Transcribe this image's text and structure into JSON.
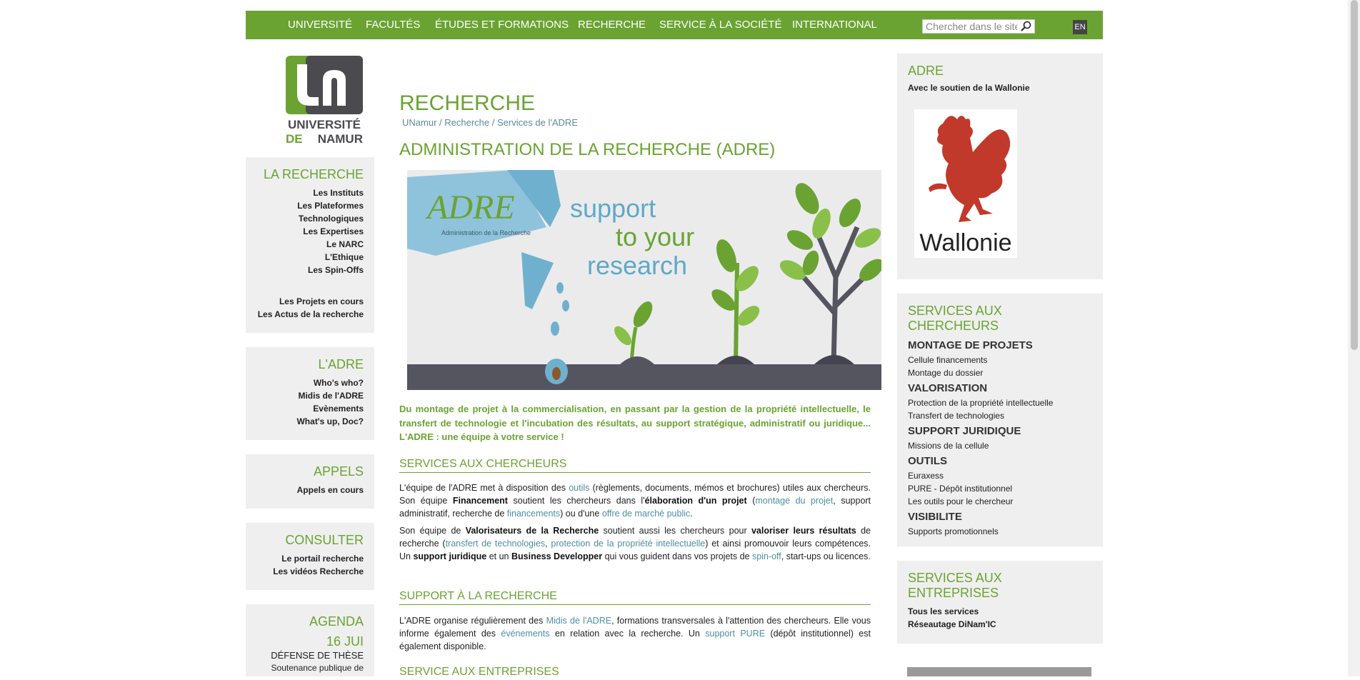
{
  "nav": {
    "items": [
      "UNIVERSITÉ",
      "FACULTÉS",
      "ÉTUDES ET FORMATIONS",
      "RECHERCHE",
      "SERVICE À LA SOCIÉTÉ",
      "INTERNATIONAL"
    ],
    "search_placeholder": "Chercher dans le site",
    "lang": "EN"
  },
  "logo": {
    "line1": "UNIVERSITÉ",
    "line2a": "DE",
    "line2b": "NAMUR"
  },
  "left": {
    "recherche": {
      "title": "LA RECHERCHE",
      "items": [
        "Les Instituts",
        "Les Plateformes",
        "Technologiques",
        "Les Expertises",
        "Le NARC",
        "L'Ethique",
        "Les Spin-Offs"
      ],
      "items2": [
        "Les Projets en cours",
        "Les Actus de la recherche"
      ]
    },
    "adre": {
      "title": "L'ADRE",
      "items": [
        "Who's who?",
        "Midis de l'ADRE",
        "Evènements",
        "What's up, Doc?"
      ]
    },
    "appels": {
      "title": "APPELS",
      "items": [
        "Appels en cours"
      ]
    },
    "consulter": {
      "title": "CONSULTER",
      "items": [
        "Le portail recherche",
        "Les vidéos Recherche"
      ]
    },
    "agenda": {
      "title": "AGENDA",
      "date": "16 JUI",
      "event": "DÉFENSE DE THÈSE",
      "desc": "Soutenance publique de"
    }
  },
  "main": {
    "heading": "RECHERCHE",
    "breadcrumb": [
      "UNamur",
      "Recherche",
      "Services de l'ADRE"
    ],
    "breadcrumb_sep": " / ",
    "title": "ADMINISTRATION DE LA RECHERCHE (ADRE)",
    "hero": {
      "logo": "ADRE",
      "logo_sub": "Administration de la Recherche",
      "line1": "support",
      "line2": "to your",
      "line3": "research"
    },
    "intro": "Du montage de projet à la commercialisation, en passant par la gestion de la propriété intellectuelle, le transfert de technologie et l'incubation des résultats, au support stratégique, administratif ou juridique... L'ADRE : une équipe à votre service !",
    "s1_title": "SERVICES AUX CHERCHEURS",
    "p1": {
      "t1": "L'équipe de l'ADRE met à disposition des ",
      "a1": "outils",
      "t2": " (règlements, documents, mémos et brochures) utiles aux chercheurs.  Son équipe ",
      "b1": "Financement",
      "t3": " soutient les chercheurs dans l'",
      "b2": "élaboration d'un projet",
      "t4": " (",
      "a2": "montage du projet",
      "t5": ", support administratif, recherche de ",
      "a3": "financements",
      "t6": ") ou d'une ",
      "a4": "offre de marché public",
      "t7": "."
    },
    "p2": {
      "t1": "Son équipe de ",
      "b1": "Valorisateurs de la Recherche",
      "t2": " soutient aussi les chercheurs pour ",
      "b2": "valoriser leurs résultats",
      "t3": " de recherche (",
      "a1": "transfert de technologies",
      "t4": ", ",
      "a2": "protection de la propriété intellectuelle",
      "t5": ") et ainsi promouvoir leurs compétences.  Un ",
      "b3": "support juridique",
      "t6": " et un ",
      "b4": "Business Developper",
      "t7": " qui vous guident dans vos projets de ",
      "a3": "spin-off",
      "t8": ", start-ups ou licences."
    },
    "s2_title": "SUPPORT À LA RECHERCHE",
    "p3": {
      "t1": "L'ADRE organise régulièrement des ",
      "a1": "Midis de l'ADRE",
      "t2": ", formations transversales à l'attention des chercheurs. Elle vous informe également des ",
      "a2": "événements",
      "t3": " en relation avec la recherche.  Un ",
      "a3": "support PURE",
      "t4": " (dépôt institutionnel) est également disponible."
    },
    "s3_title": "SERVICE AUX ENTREPRISES"
  },
  "right": {
    "adre": {
      "title": "ADRE",
      "subtitle": "Avec le soutien de la Wallonie",
      "logo_text": "Wallonie"
    },
    "chercheurs": {
      "title": "SERVICES AUX CHERCHEURS",
      "groups": [
        {
          "cat": "MONTAGE DE PROJETS",
          "items": [
            "Cellule financements",
            "Montage du dossier"
          ]
        },
        {
          "cat": "VALORISATION",
          "items": [
            "Protection de la propriété intellectuelle",
            "Transfert de technologies"
          ]
        },
        {
          "cat": "SUPPORT JURIDIQUE",
          "items": [
            "Missions de la cellule"
          ]
        },
        {
          "cat": "OUTILS",
          "items": [
            "Euraxess",
            "PURE - Dépôt institutionnel",
            "Les outils pour le chercheur"
          ]
        },
        {
          "cat": "VISIBILITE",
          "items": [
            "Supports promotionnels"
          ]
        }
      ]
    },
    "entreprises": {
      "title": "SERVICES AUX ENTREPRISES",
      "items": [
        "Tous les services",
        "Réseautage DiNam'IC"
      ]
    }
  },
  "colors": {
    "accent": "#6aa332",
    "link": "#4d8fa0",
    "sidebar_bg": "#efefef"
  }
}
